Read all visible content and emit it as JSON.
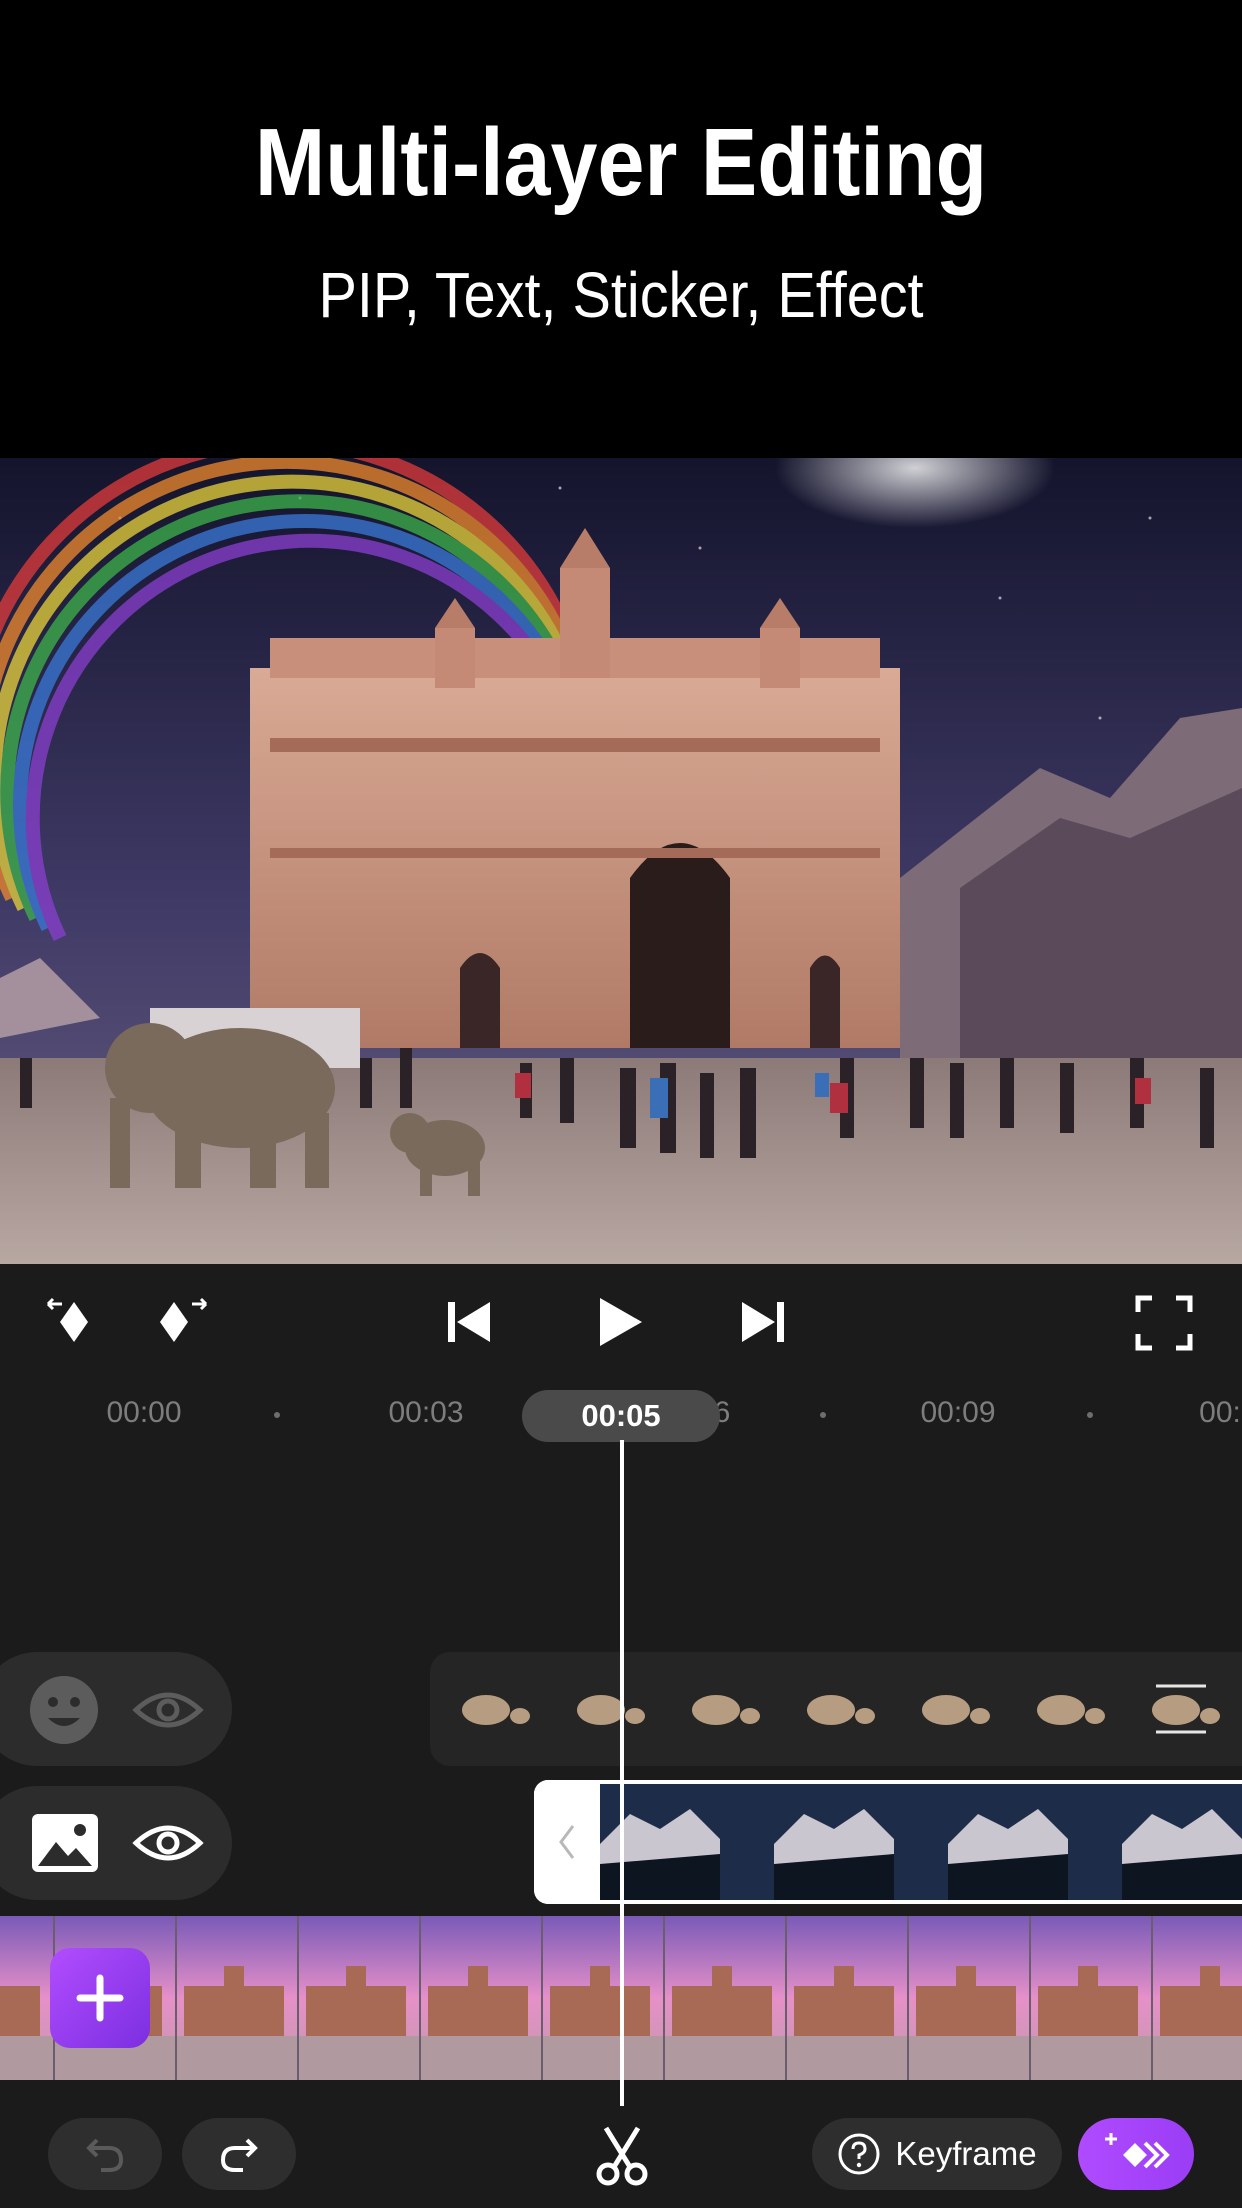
{
  "promo": {
    "title": "Multi-layer Editing",
    "subtitle": "PIP, Text, Sticker, Effect"
  },
  "player": {
    "current_time": "00:05",
    "controls": [
      "keyframe-prev-icon",
      "keyframe-next-icon",
      "skip-back-icon",
      "play-icon",
      "skip-forward-icon",
      "fullscreen-icon"
    ]
  },
  "ruler": {
    "labels": [
      "00:00",
      "00:03",
      "6",
      "00:09",
      "00:"
    ]
  },
  "tracks": {
    "sticker": {
      "type_icon": "smiley-icon",
      "visibility_icon": "eye-icon"
    },
    "pip": {
      "type_icon": "image-icon",
      "visibility_icon": "eye-icon"
    }
  },
  "toolbar": {
    "add_icon": "plus-icon",
    "undo_icon": "undo-icon",
    "redo_icon": "redo-icon",
    "split_icon": "scissors-icon",
    "keyframe_label": "Keyframe",
    "help_icon": "question-icon",
    "ai_icon": "sparkle-keyframe-icon"
  },
  "colors": {
    "accent": "#9b3ff5",
    "editor_bg": "#1b1b1b",
    "track_ctrl_bg": "#2c2c2c"
  }
}
